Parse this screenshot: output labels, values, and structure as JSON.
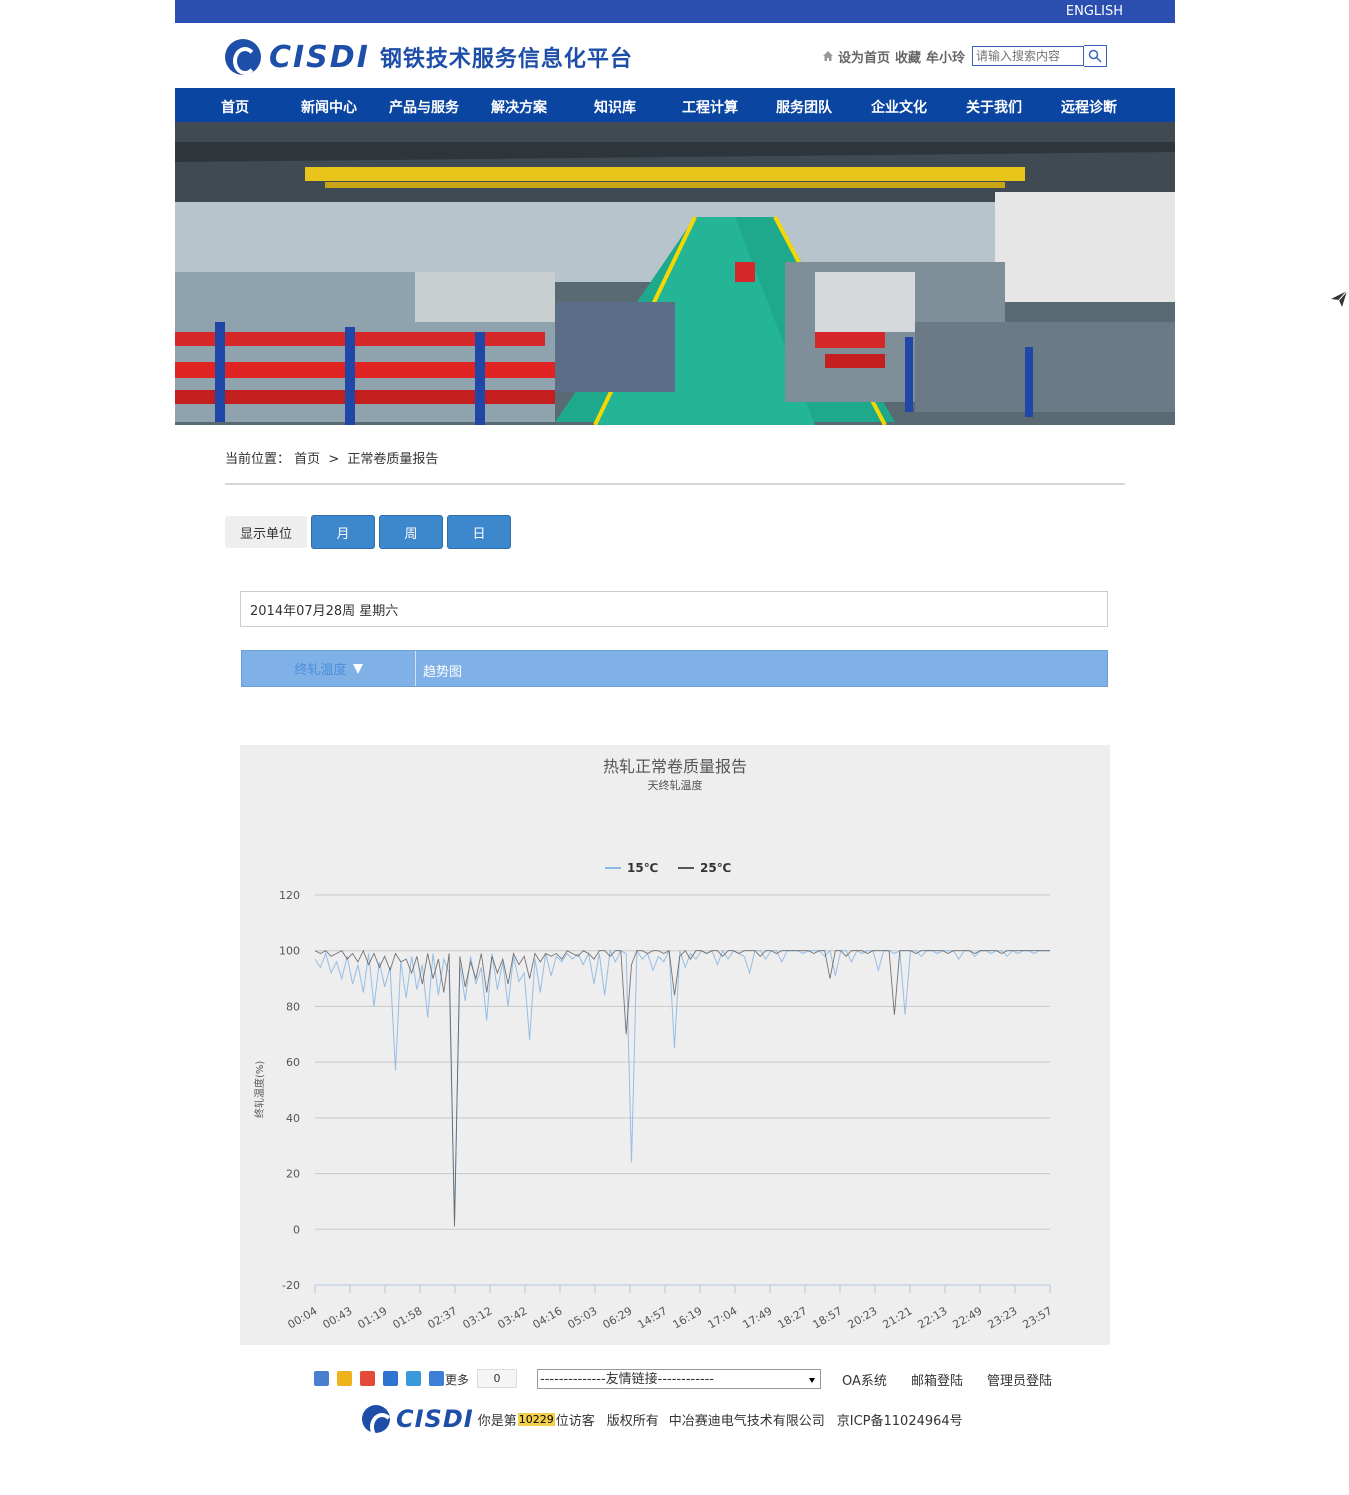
{
  "topbar": {
    "english": "ENGLISH"
  },
  "header": {
    "logo_text": "CISDI",
    "logo_cn": "钢铁技术服务信息化平台",
    "set_home": "设为首页",
    "favorite": "收藏",
    "xiaoling": "牟小玲",
    "search_placeholder": "请输入搜索内容"
  },
  "nav": {
    "items": [
      {
        "label": "首页"
      },
      {
        "label": "新闻中心"
      },
      {
        "label": "产品与服务"
      },
      {
        "label": "解决方案"
      },
      {
        "label": "知识库"
      },
      {
        "label": "工程计算"
      },
      {
        "label": "服务团队"
      },
      {
        "label": "企业文化"
      },
      {
        "label": "关于我们"
      },
      {
        "label": "远程诊断"
      }
    ]
  },
  "breadcrumb": {
    "prefix": "当前位置：",
    "home": "首页",
    "separator": ">",
    "current": "正常卷质量报告"
  },
  "units": {
    "label": "显示单位",
    "month": "月",
    "week": "周",
    "day": "日"
  },
  "date_text": "2014年07月28周 星期六",
  "tabs": {
    "selector": "终轧温度",
    "trend": "趋势图"
  },
  "chart_data": {
    "type": "line",
    "title": "热轧正常卷质量报告",
    "subtitle": "天终轧温度",
    "ylabel": "终轧温度(%)",
    "ylim": [
      -20,
      120
    ],
    "yticks": [
      -20,
      0,
      20,
      40,
      60,
      80,
      100,
      120
    ],
    "xticklabels": [
      "00:04",
      "00:43",
      "01:19",
      "01:58",
      "02:37",
      "03:12",
      "03:42",
      "04:16",
      "05:03",
      "06:29",
      "14:57",
      "16:19",
      "17:04",
      "17:49",
      "18:27",
      "18:57",
      "20:23",
      "21:21",
      "22:13",
      "22:49",
      "23:23",
      "23:57"
    ],
    "legend_position": "top-center",
    "series": [
      {
        "name": "15℃",
        "color": "#8db8e3",
        "values": [
          97,
          94,
          99,
          92,
          96,
          90,
          98,
          88,
          95,
          85,
          99,
          80,
          96,
          87,
          94,
          57,
          96,
          83,
          98,
          86,
          95,
          76,
          99,
          84,
          97,
          92,
          3,
          95,
          82,
          98,
          88,
          94,
          75,
          99,
          86,
          96,
          80,
          98,
          89,
          92,
          68,
          97,
          85,
          99,
          91,
          98,
          96,
          99,
          97,
          99,
          95,
          99,
          88,
          99,
          84,
          100,
          96,
          100,
          99,
          24,
          100,
          97,
          99,
          93,
          98,
          96,
          100,
          65,
          100,
          94,
          99,
          97,
          100,
          99,
          100,
          95,
          100,
          97,
          100,
          99,
          98,
          92,
          100,
          100,
          97,
          100,
          100,
          96,
          100,
          100,
          100,
          99,
          100,
          100,
          100,
          98,
          100,
          91,
          100,
          100,
          96,
          100,
          99,
          100,
          100,
          93,
          100,
          100,
          99,
          100,
          77,
          100,
          100,
          98,
          100,
          100,
          99,
          100,
          100,
          100,
          97,
          100,
          100,
          98,
          100,
          100,
          99,
          100,
          100,
          98,
          100,
          99,
          100,
          100,
          99,
          100,
          100,
          100
        ]
      },
      {
        "name": "25℃",
        "color": "#555555",
        "values": [
          100,
          99,
          100,
          98,
          99,
          100,
          97,
          99,
          96,
          100,
          95,
          99,
          94,
          98,
          93,
          99,
          96,
          97,
          92,
          98,
          88,
          99,
          90,
          97,
          85,
          99,
          1,
          98,
          87,
          96,
          90,
          99,
          85,
          98,
          92,
          97,
          88,
          99,
          95,
          98,
          90,
          99,
          96,
          99,
          98,
          99,
          97,
          100,
          99,
          98,
          100,
          99,
          97,
          100,
          100,
          98,
          100,
          100,
          70,
          95,
          100,
          100,
          99,
          100,
          100,
          99,
          100,
          84,
          98,
          100,
          97,
          100,
          100,
          99,
          100,
          100,
          98,
          100,
          100,
          99,
          100,
          100,
          100,
          98,
          100,
          100,
          99,
          100,
          100,
          100,
          100,
          100,
          100,
          99,
          100,
          100,
          90,
          100,
          100,
          98,
          100,
          100,
          100,
          99,
          100,
          100,
          100,
          100,
          77,
          100,
          100,
          100,
          99,
          100,
          100,
          100,
          100,
          100,
          99,
          100,
          100,
          100,
          100,
          99,
          100,
          100,
          100,
          100,
          99,
          100,
          100,
          100,
          100,
          100,
          100,
          100,
          100,
          100
        ]
      }
    ]
  },
  "footer": {
    "more": "更多",
    "share_count": "0",
    "links_select": "--------------友情链接------------",
    "oa": "OA系统",
    "mail": "邮箱登陆",
    "admin": "管理员登陆",
    "visitor_prefix": "你是第",
    "visitor_count": "10229",
    "visitor_suffix": "位访客",
    "rights": "版权所有",
    "company": "中冶赛迪电气技术有限公司",
    "icp": "京ICP备11024964号"
  }
}
